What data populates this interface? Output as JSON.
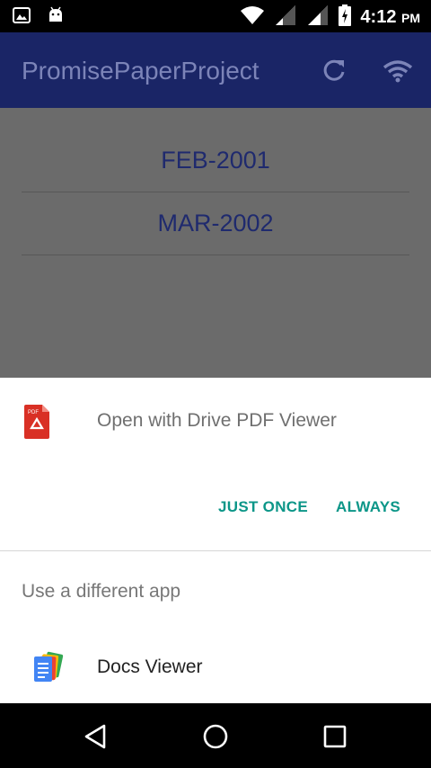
{
  "status_bar": {
    "time": "4:12",
    "ampm": "PM",
    "icons": [
      "image-icon",
      "android-icon",
      "wifi-icon",
      "signal-icon",
      "signal-icon",
      "battery-charging-icon"
    ]
  },
  "app_bar": {
    "title": "PromisePaperProject",
    "icons": [
      "refresh-icon",
      "wifi-icon"
    ]
  },
  "list": {
    "items": [
      "FEB-2001",
      "MAR-2002"
    ]
  },
  "dialog": {
    "title": "Open with Drive PDF Viewer",
    "just_once": "JUST ONCE",
    "always": "ALWAYS",
    "different_app": "Use a different app",
    "apps": [
      {
        "label": "Docs Viewer",
        "icon": "docs-viewer-icon"
      }
    ]
  },
  "colors": {
    "accent": "#0c9688",
    "app_bar": "#1a2566",
    "scrim_bg": "#6b6b6b"
  }
}
